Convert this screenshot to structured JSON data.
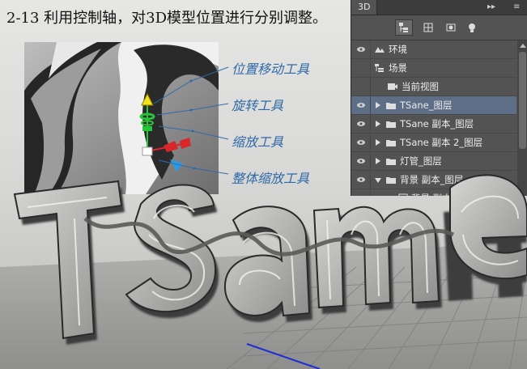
{
  "caption": "2-13 利用控制轴，对3D模型位置进行分别调整。",
  "callouts": [
    {
      "label": "位置移动工具"
    },
    {
      "label": "旋转工具"
    },
    {
      "label": "缩放工具"
    },
    {
      "label": "整体缩放工具"
    }
  ],
  "panel": {
    "tab": "3D",
    "collapse_glyph": "▸▸",
    "menu_glyph": "≡",
    "toolbar_icons": [
      "scene-filter-icon",
      "mesh-filter-icon",
      "material-filter-icon",
      "light-filter-icon"
    ],
    "rows": [
      {
        "label": "环境",
        "icon": "environment-icon",
        "depth": 0,
        "expand": "none"
      },
      {
        "label": "场景",
        "icon": "scene-icon",
        "depth": 0,
        "expand": "none"
      },
      {
        "label": "当前视图",
        "icon": "camera-icon",
        "depth": 1,
        "expand": "none"
      },
      {
        "label": "TSane_图层",
        "icon": "folder-icon",
        "depth": 1,
        "expand": "closed",
        "selected": true
      },
      {
        "label": "TSane 副本_图层",
        "icon": "folder-icon",
        "depth": 1,
        "expand": "closed"
      },
      {
        "label": "TSane 副本 2_图层",
        "icon": "folder-icon",
        "depth": 1,
        "expand": "closed"
      },
      {
        "label": "灯管_图层",
        "icon": "folder-icon",
        "depth": 1,
        "expand": "closed"
      },
      {
        "label": "背景 副本_图层",
        "icon": "folder-icon",
        "depth": 1,
        "expand": "open"
      },
      {
        "label": "背景 副本_图层",
        "icon": "mesh-icon",
        "depth": 2,
        "expand": "open"
      }
    ]
  },
  "scene_text": "TSane",
  "colors": {
    "callout_blue": "#2f6aa8",
    "panel_bg": "#535353",
    "selected_row": "#5d6e86",
    "axis_blue": "#1f2dd6",
    "gizmo_yellow": "#f2e21a",
    "gizmo_green": "#27c43a",
    "gizmo_red": "#d9262a",
    "gizmo_cyan": "#2b9be8"
  }
}
